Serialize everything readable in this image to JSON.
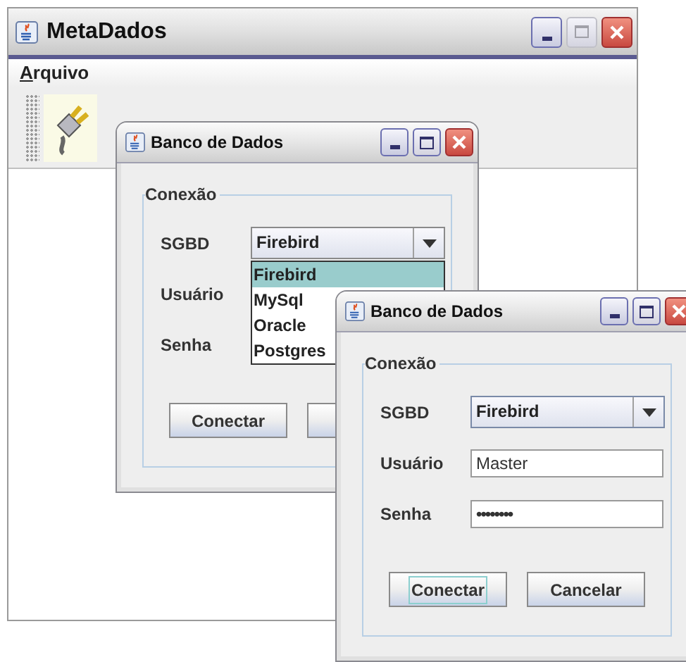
{
  "main_window": {
    "title": "MetaDados",
    "menu": [
      {
        "mnemonic": "A",
        "rest": "rquivo"
      }
    ],
    "toolbar": [
      {
        "kind": "plug"
      }
    ]
  },
  "dialogs": [
    {
      "title": "Banco de Dados",
      "group": "Conexão",
      "fields": [
        {
          "kind": "combo",
          "label": "SGBD",
          "value": "Firebird",
          "expanded": true,
          "options": [
            {
              "label": "Firebird",
              "selected": true
            },
            {
              "label": "MySql",
              "selected": false
            },
            {
              "label": "Oracle",
              "selected": false
            },
            {
              "label": "Postgres",
              "selected": false
            }
          ]
        },
        {
          "kind": "label",
          "label": "Usuário"
        },
        {
          "kind": "label",
          "label": "Senha"
        }
      ],
      "buttons": [
        {
          "kind": "button",
          "label": "Conectar",
          "focused": false
        },
        {
          "kind": "covered"
        }
      ]
    },
    {
      "title": "Banco de Dados",
      "group": "Conexão",
      "fields": [
        {
          "kind": "combo",
          "label": "SGBD",
          "value": "Firebird",
          "expanded": false
        },
        {
          "kind": "text",
          "label": "Usuário",
          "value": "Master"
        },
        {
          "kind": "password",
          "label": "Senha",
          "value": "••••••••"
        }
      ],
      "buttons": [
        {
          "kind": "button",
          "label": "Conectar",
          "focused": true
        },
        {
          "kind": "button",
          "label": "Cancelar",
          "focused": false
        }
      ]
    }
  ]
}
